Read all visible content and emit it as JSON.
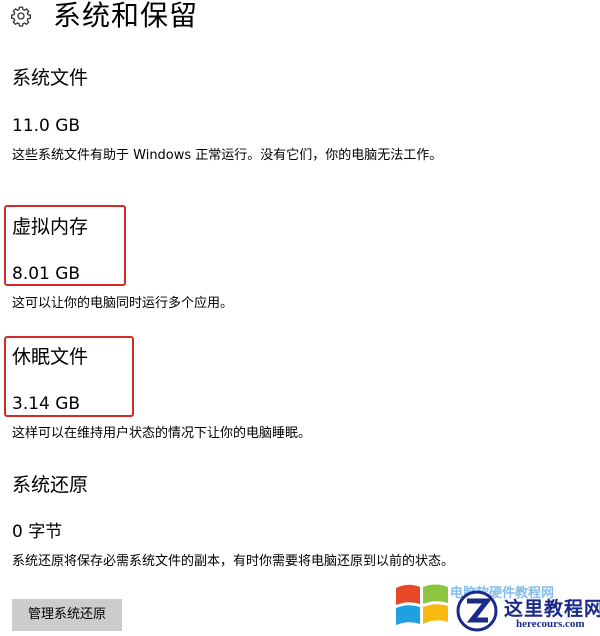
{
  "header": {
    "title": "系统和保留",
    "icon": "gear-icon"
  },
  "sections": [
    {
      "heading": "系统文件",
      "size": "11.0 GB",
      "description": "这些系统文件有助于 Windows 正常运行。没有它们，你的电脑无法工作。"
    },
    {
      "heading": "虚拟内存",
      "size": "8.01 GB",
      "description": "这可以让你的电脑同时运行多个应用。"
    },
    {
      "heading": "休眠文件",
      "size": "3.14 GB",
      "description": "这样可以在维持用户状态的情况下让你的电脑睡眠。"
    },
    {
      "heading": "系统还原",
      "size": "0 字节",
      "description": "系统还原将保存必需系统文件的副本，有时你需要将电脑还原到以前的状态。"
    }
  ],
  "manage_button_label": "管理系统还原",
  "highlight_color": "#d42a2a",
  "watermark": {
    "overlay_text": "电脑软硬件教程网",
    "site_name": "这里教程网",
    "url": "herecours.com"
  }
}
